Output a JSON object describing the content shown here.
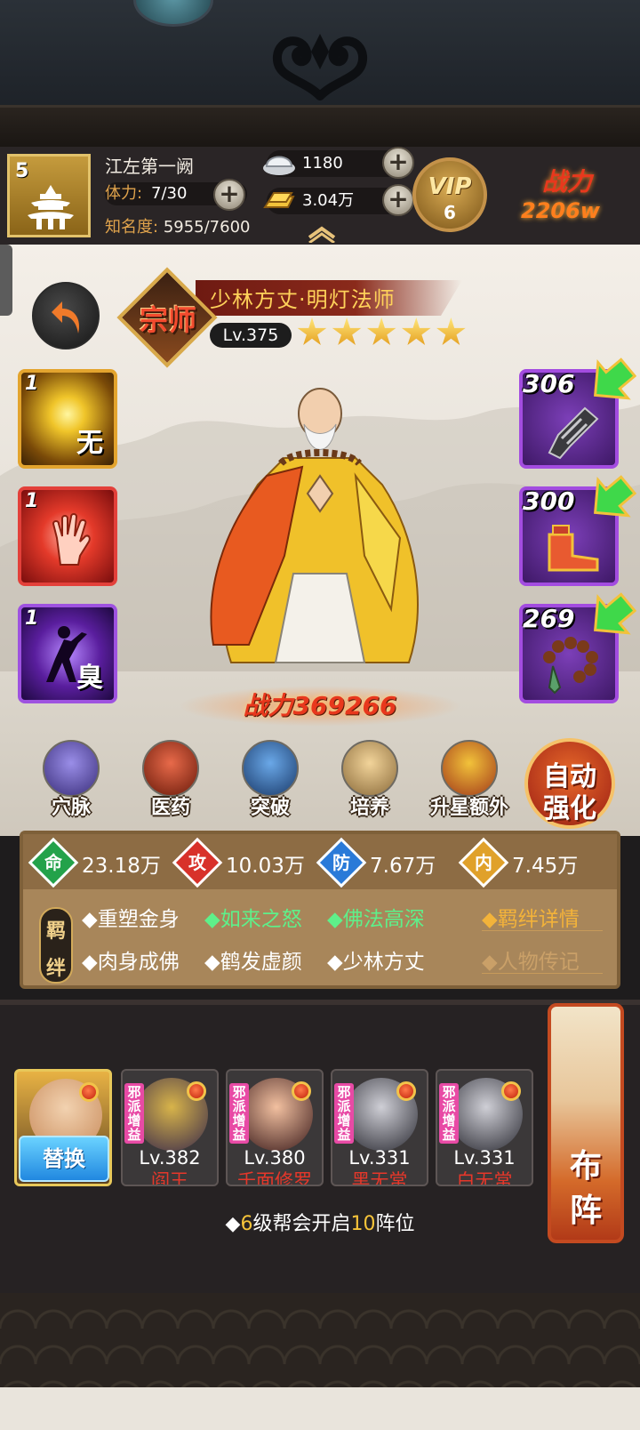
{
  "header": {
    "player_level": "5",
    "player_name": "江左第一阙",
    "stamina_label": "体力:",
    "stamina_value": "7/30",
    "fame_label": "知名度:",
    "fame_value": "5955/7600",
    "silver": "1180",
    "gold": "3.04万",
    "vip_label": "VIP",
    "vip_level": "6",
    "power_label": "战力",
    "power_value": "2206w"
  },
  "hero": {
    "rank": "宗师",
    "name": "少林方丈·明灯法师",
    "level": "Lv.375",
    "stars": 5,
    "power_label": "战力",
    "power_value": "369266"
  },
  "skills": [
    {
      "count": "1",
      "glyph": "无",
      "icon": "golden-orb-icon"
    },
    {
      "count": "1",
      "glyph": "",
      "icon": "palm-icon"
    },
    {
      "count": "1",
      "glyph": "臭",
      "icon": "shadow-dancer-icon"
    }
  ],
  "equipment": [
    {
      "level": "306",
      "icon": "gauntlet-icon"
    },
    {
      "level": "300",
      "icon": "boots-icon"
    },
    {
      "level": "269",
      "icon": "prayer-beads-icon"
    }
  ],
  "functions": [
    {
      "label": "穴脉",
      "icon": "meridian-icon"
    },
    {
      "label": "医药",
      "icon": "medicine-icon"
    },
    {
      "label": "突破",
      "icon": "breakthrough-icon"
    },
    {
      "label": "培养",
      "icon": "scroll-icon"
    },
    {
      "label": "升星额外",
      "icon": "treasure-icon"
    }
  ],
  "auto_enhance": {
    "line1": "自动",
    "line2": "强化"
  },
  "stats": [
    {
      "char": "命",
      "value": "23.18万",
      "color": "#23a24a"
    },
    {
      "char": "攻",
      "value": "10.03万",
      "color": "#d8312a"
    },
    {
      "char": "防",
      "value": "7.67万",
      "color": "#2a7ad8"
    },
    {
      "char": "内",
      "value": "7.45万",
      "color": "#e0a12a"
    }
  ],
  "bond_tag": {
    "c1": "羁",
    "c2": "绊"
  },
  "bonds": [
    {
      "text": "◆重塑金身",
      "active": false
    },
    {
      "text": "◆如来之怒",
      "active": true
    },
    {
      "text": "◆佛法高深",
      "active": true
    },
    {
      "text": "◆肉身成佛",
      "active": false
    },
    {
      "text": "◆鹤发虚颜",
      "active": false
    },
    {
      "text": "◆少林方丈",
      "active": false
    }
  ],
  "links": {
    "bond_detail": "◆羁绊详情",
    "biography": "◆人物传记"
  },
  "formation": {
    "swap_label": "替换",
    "buff_tag": "邪派增益",
    "members": [
      {
        "level": "Lv.382",
        "name": "阎王"
      },
      {
        "level": "Lv.380",
        "name": "千面修罗"
      },
      {
        "level": "Lv.331",
        "name": "黑无常"
      },
      {
        "level": "Lv.331",
        "name": "白无常"
      }
    ],
    "button_c1": "布",
    "button_c2": "阵",
    "tip_prefix": "◆",
    "tip_num1": "6",
    "tip_mid": "级帮会开启",
    "tip_num2": "10",
    "tip_suffix": "阵位"
  }
}
